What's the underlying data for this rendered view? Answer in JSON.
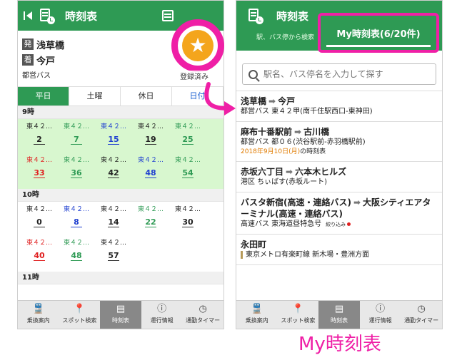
{
  "left": {
    "header_title": "時刻表",
    "route": {
      "from_tag": "発",
      "from_name": "浅草橋",
      "to_tag": "着",
      "to_name": "今戸",
      "operator": "都営バス"
    },
    "registered_label": "登録済み",
    "tabs": [
      "平日",
      "土曜",
      "休日",
      "日付"
    ],
    "hours": [
      {
        "label": "9時",
        "departures": [
          {
            "route": "東４２…",
            "minute": "2",
            "color": "black"
          },
          {
            "route": "東４２…",
            "minute": "7",
            "color": "green"
          },
          {
            "route": "東４２…",
            "minute": "15",
            "color": "blue"
          },
          {
            "route": "東４２…",
            "minute": "19",
            "color": "black"
          },
          {
            "route": "東４２…",
            "minute": "25",
            "color": "green"
          },
          {
            "route": "東４２…",
            "minute": "33",
            "color": "red"
          },
          {
            "route": "東４２…",
            "minute": "36",
            "color": "green"
          },
          {
            "route": "東４２…",
            "minute": "42",
            "color": "black"
          },
          {
            "route": "東４２…",
            "minute": "48",
            "color": "blue"
          },
          {
            "route": "東４２…",
            "minute": "54",
            "color": "green"
          }
        ]
      },
      {
        "label": "10時",
        "departures": [
          {
            "route": "東４２…",
            "minute": "0",
            "color": "black"
          },
          {
            "route": "東４２…",
            "minute": "8",
            "color": "blue"
          },
          {
            "route": "東４２…",
            "minute": "14",
            "color": "black"
          },
          {
            "route": "東４２…",
            "minute": "22",
            "color": "green"
          },
          {
            "route": "東４２…",
            "minute": "30",
            "color": "black"
          },
          {
            "route": "東４２…",
            "minute": "40",
            "color": "red"
          },
          {
            "route": "東４２…",
            "minute": "48",
            "color": "green"
          },
          {
            "route": "東４２…",
            "minute": "57",
            "color": "black"
          }
        ]
      },
      {
        "label": "11時",
        "departures": []
      }
    ]
  },
  "right": {
    "header_title": "時刻表",
    "subheader": "駅、バス停から検索",
    "my_tab": "My時刻表(6/20件)",
    "search_placeholder": "駅名、バス停名を入力して探す",
    "items": [
      {
        "from": "浅草橋",
        "to": "今戸",
        "sub": "都営バス 東４２甲(南千住駅西口-東神田)"
      },
      {
        "from": "麻布十番駅前",
        "to": "古川橋",
        "sub": "都営バス 都０６(渋谷駅前-赤羽橋駅前)",
        "date": "2018年9月10日(月)",
        "date_suffix": "の時刻表"
      },
      {
        "from": "赤坂六丁目",
        "to": "六本木ヒルズ",
        "sub": "港区 ちぃばす(赤坂ルート)"
      },
      {
        "from": "バスタ新宿(高速・連絡バス)",
        "to": "大阪シティエアターミナル(高速・連絡バス)",
        "sub": "高速バス 東海道昼特急号",
        "filter": "絞り込み"
      },
      {
        "from": "永田町",
        "sub": "東京メトロ有楽町線 新木場・豊洲方面"
      }
    ]
  },
  "nav": [
    {
      "label": "乗換案内",
      "icon": "train-icon"
    },
    {
      "label": "スポット検索",
      "icon": "pin-icon"
    },
    {
      "label": "時刻表",
      "icon": "timetable-icon"
    },
    {
      "label": "運行情報",
      "icon": "info-icon"
    },
    {
      "label": "通勤タイマー",
      "icon": "timer-icon"
    }
  ],
  "caption": "My時刻表",
  "colors": {
    "green": "#2e9a54",
    "magenta": "#ef1fa6",
    "star": "#f4a51c"
  }
}
